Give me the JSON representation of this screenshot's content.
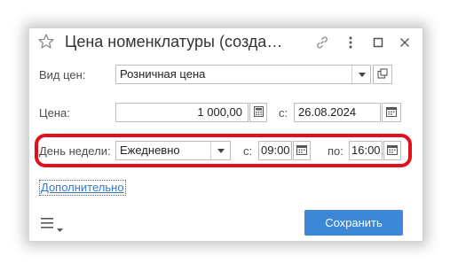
{
  "window": {
    "title": "Цена номенклатуры (созда…"
  },
  "titlebar": {
    "icons": [
      "star-icon",
      "link-icon",
      "more-icon",
      "maximize-icon",
      "close-icon"
    ]
  },
  "form": {
    "price_type": {
      "label": "Вид цен:",
      "value": "Розничная цена"
    },
    "price": {
      "label": "Цена:",
      "value": "1 000,00",
      "from_label": "с:",
      "from_date": "26.08.2024"
    },
    "weekday": {
      "label": "День недели:",
      "value": "Ежедневно",
      "time_from_label": "с:",
      "time_from": "09:00",
      "time_to_label": "по:",
      "time_to": "16:00"
    },
    "more_link": "Дополнительно"
  },
  "footer": {
    "save_label": "Сохранить"
  },
  "colors": {
    "accent": "#3c88d6",
    "highlight": "#e3101b",
    "link": "#3b78c3"
  }
}
